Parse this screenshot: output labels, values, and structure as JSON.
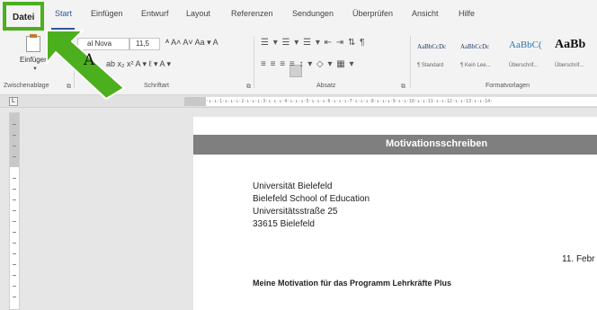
{
  "tabs": [
    {
      "label": "Datei"
    },
    {
      "label": "Start"
    },
    {
      "label": "Einfügen"
    },
    {
      "label": "Entwurf"
    },
    {
      "label": "Layout"
    },
    {
      "label": "Referenzen"
    },
    {
      "label": "Sendungen"
    },
    {
      "label": "Überprüfen"
    },
    {
      "label": "Ansicht"
    },
    {
      "label": "Hilfe"
    }
  ],
  "ribbon": {
    "clipboard": {
      "paste_label": "Einfügen",
      "group_label": "Zwischenablage",
      "launcher": "⧉"
    },
    "font": {
      "name": "al Nova",
      "size": "11,5",
      "row1_tools": "ᴬ A˄ A˅  Aa ▾   A",
      "row2_tools": "ab  x₂  x²   A ▾  ℓ ▾  A ▾",
      "group_label": "Schriftart",
      "launcher": "⧉"
    },
    "paragraph": {
      "row1": "☰ ▾ ☰ ▾ ☰ ▾  ⇤ ⇥  ⇅  ¶",
      "row2": "≡ ≡ ≡ ≡  ↕ ▾   ◇ ▾ ▦ ▾",
      "group_label": "Absatz",
      "launcher": "⧉"
    },
    "styles": {
      "items": [
        {
          "preview": "AaBbCcDc",
          "name": "¶ Standard"
        },
        {
          "preview": "AaBbCcDc",
          "name": "¶ Kein Lee..."
        },
        {
          "preview": "AaBbC(",
          "name": "Überschrif..."
        },
        {
          "preview": "AaBb",
          "name": "Überschrif..."
        }
      ],
      "group_label": "Formatvorlagen"
    }
  },
  "ruler": {
    "corner": "L",
    "scale": "·2·ı·1·ı·ı·ı·1·ı·ı·ı·2·ı·ı·ı·3·ı·ı·ı·4·ı·ı·ı·5·ı·ı·ı·6·ı·ı·ı·7·ı·ı·ı·8·ı·ı·ı·9·ı·ı·10·ı·ı·11·ı·ı·12·ı·ı·13·ı·ı·14·"
  },
  "document": {
    "header_title": "Motivationsschreiben",
    "address_lines": [
      "Universität Bielefeld",
      "Bielefeld School of Education",
      "Universitätsstraße 25",
      "33615 Bielefeld"
    ],
    "date": "11. Febr",
    "subject": "Meine Motivation für das Programm Lehrkräfte Plus"
  },
  "annotation": {
    "letter": "A",
    "color": "#4caf1e"
  }
}
